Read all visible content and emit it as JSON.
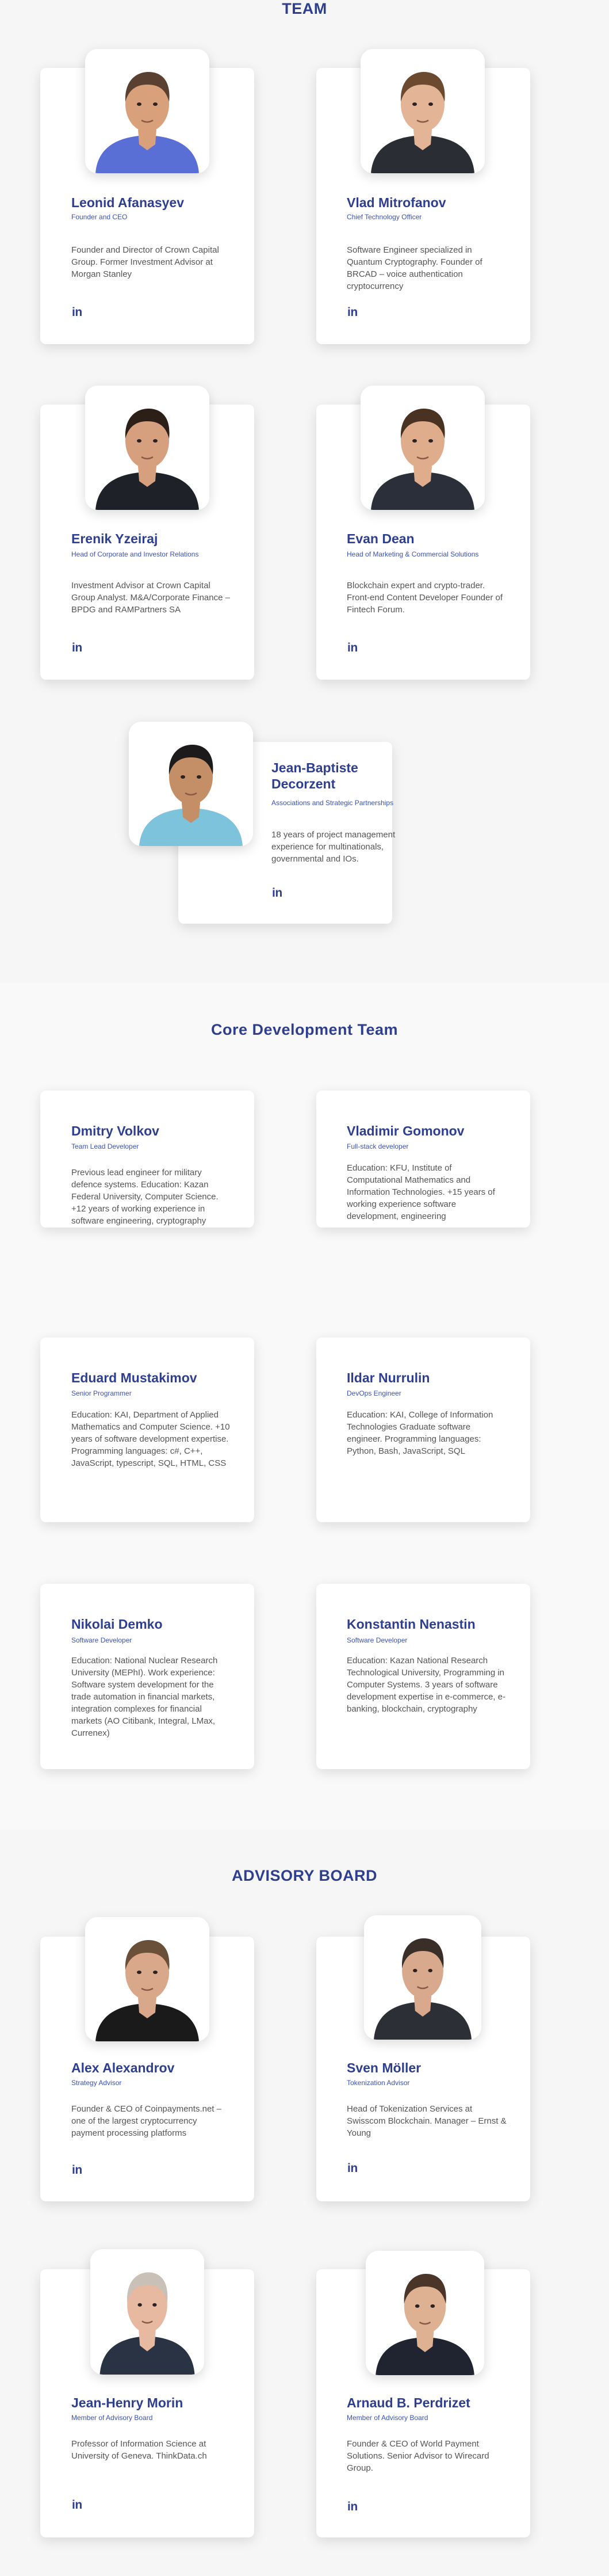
{
  "team": {
    "title": "TEAM",
    "members": [
      {
        "name": "Leonid Afanasyev",
        "role": "Founder and CEO",
        "desc": "Founder and Director of Crown Capital Group. Former Investment Advisor at Morgan Stanley",
        "linkedin": "in",
        "shirt": "#5a6fd6",
        "skin": "#d9a07c",
        "hair": "#5a4030"
      },
      {
        "name": "Vlad Mitrofanov",
        "role": "Chief Technology Officer",
        "desc": "Software Engineer specialized in Quantum Cryptography. Founder of BRCAD – voice authentication cryptocurrency",
        "linkedin": "in",
        "shirt": "#2a2d33",
        "skin": "#e3b496",
        "hair": "#6b4a30"
      },
      {
        "name": "Erenik Yzeiraj",
        "role": "Head of Corporate and Investor Relations",
        "desc": "Investment Advisor at Crown Capital Group Analyst. M&A/Corporate Finance –BPDG and RAMPartners SA",
        "linkedin": "in",
        "shirt": "#1e2228",
        "skin": "#d6a07e",
        "hair": "#2b1f18"
      },
      {
        "name": "Evan Dean",
        "role": "Head of Marketing & Commercial Solutions",
        "desc": "Blockchain expert and crypto-trader. Front-end Content Developer Founder of Fintech Forum.",
        "linkedin": "in",
        "shirt": "#2b2f3a",
        "skin": "#e0ad8c",
        "hair": "#4a3222"
      },
      {
        "name": "Jean-Baptiste Decorzent",
        "role": "Associations and Strategic Partnerships",
        "desc": "18 years of project management experience for multinationals, governmental and IOs.",
        "linkedin": "in",
        "shirt": "#7ec3dc",
        "skin": "#c48e66",
        "hair": "#1c1a1a"
      }
    ]
  },
  "core": {
    "title": "Core Development Team",
    "members": [
      {
        "name": "Dmitry Volkov",
        "role": "Team Lead Developer",
        "desc": "Previous lead engineer for military defence systems. Education: Kazan Federal University, Computer Science. +12 years of working experience in software engineering, cryptography"
      },
      {
        "name": "Vladimir Gomonov",
        "role": "Full-stack developer",
        "desc": "Education: KFU, Institute of Computational Mathematics and Information Technologies. +15 years of working experience software development, engineering"
      },
      {
        "name": "Eduard Mustakimov",
        "role": "Senior Programmer",
        "desc": "Education: KAI, Department of Applied Mathematics and Computer Science. +10 years of software development expertise. Programming languages: c#, C++, JavaScript, typescript, SQL, HTML, CSS"
      },
      {
        "name": "Ildar Nurrulin",
        "role": "DevOps Engineer",
        "desc": "Education: KAI, College of Information Technologies Graduate software engineer. Programming languages: Python, Bash, JavaScript, SQL"
      },
      {
        "name": "Nikolai Demko",
        "role": "Software Developer",
        "desc": "Education: National Nuclear Research University (MEPhI). Work experience: Software system development for the trade automation in financial markets, integration complexes for financial markets (AO Citibank, Integral, LMax, Currenex)"
      },
      {
        "name": "Konstantin Nenastin",
        "role": "Software Developer",
        "desc": "Education: Kazan National Research Technological University, Programming in Computer Systems. 3 years of software development expertise in e-commerce, e-banking, blockchain, cryptography"
      }
    ]
  },
  "advisory": {
    "title": "ADVISORY BOARD",
    "members": [
      {
        "name": "Alex Alexandrov",
        "role": "Strategy Advisor",
        "desc": "Founder & CEO of Coinpayments.net – one of the largest cryptocurrency payment processing platforms",
        "linkedin": "in",
        "shirt": "#1a1a1a",
        "skin": "#d9a78a",
        "hair": "#6a5038"
      },
      {
        "name": "Sven Möller",
        "role": "Tokenization Advisor",
        "desc": "Head of Tokenization Services at Swisscom Blockchain. Manager – Ernst & Young",
        "linkedin": "in",
        "shirt": "#2c2f36",
        "skin": "#d8a98c",
        "hair": "#3a2e28"
      },
      {
        "name": "Jean-Henry Morin",
        "role": "Member of Advisory Board",
        "desc": "Professor of Information Science at University of Geneva. ThinkData.ch",
        "linkedin": "in",
        "shirt": "#2a3344",
        "skin": "#e6b9a0",
        "hair": "#c9c0b8"
      },
      {
        "name": "Arnaud B. Perdrizet",
        "role": "Member of Advisory Board",
        "desc": "Founder & CEO of World Payment Solutions. Senior Advisor to Wirecard Group.",
        "linkedin": "in",
        "shirt": "#1f2430",
        "skin": "#ddb192",
        "hair": "#4a3528"
      }
    ]
  }
}
